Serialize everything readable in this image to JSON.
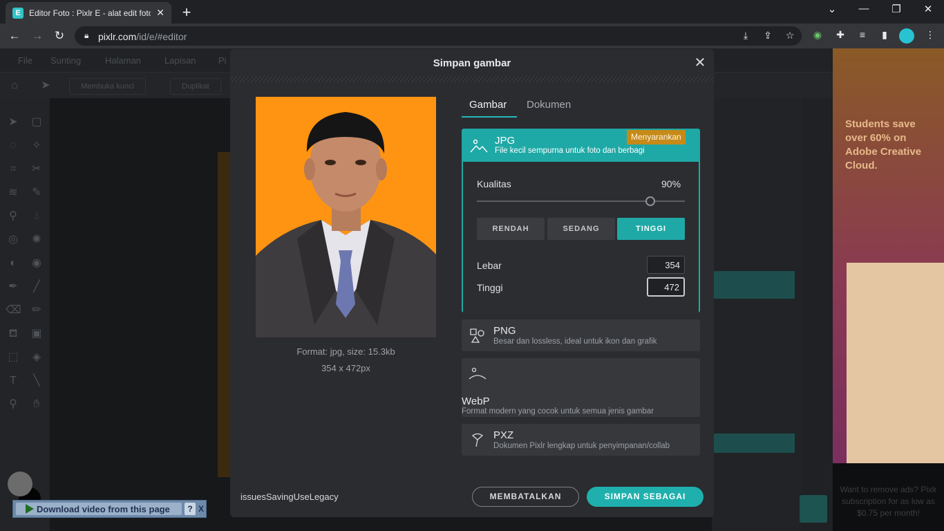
{
  "browser": {
    "tab_title": "Editor Foto : Pixlr E - alat edit foto",
    "favicon_letter": "E",
    "url_host": "pixlr.com",
    "url_path": "/id/e/#editor"
  },
  "app_bg": {
    "menu": [
      "File",
      "Sunting",
      "Halaman",
      "Lapisan",
      "Pi"
    ],
    "toolbar_buttons": [
      "Membuka kunci",
      "Duplikat"
    ],
    "ad_title": "Students save over 60% on Adobe Creative Cloud.",
    "ad_foot": "Want to remove ads? Pixlr subscription for as low as $0.75 per month!"
  },
  "download_bar": {
    "label": "Download video from this page",
    "help": "?",
    "close": "X"
  },
  "modal": {
    "title": "Simpan gambar",
    "close_icon": "✕",
    "preview_format": "Format: jpg, size: 15.3kb",
    "preview_dimensions": "354 x 472px",
    "tabs": [
      "Gambar",
      "Dokumen"
    ],
    "formats": {
      "jpg": {
        "name": "JPG",
        "desc": "File kecil sempurna untuk foto dan berbagi",
        "badge": "Menyarankan"
      },
      "png": {
        "name": "PNG",
        "desc": "Besar dan lossless, ideal untuk ikon dan grafik"
      },
      "webp": {
        "name": "WebP",
        "desc": "Format modern yang cocok untuk semua jenis gambar"
      },
      "pxz": {
        "name": "PXZ",
        "desc": "Dokumen Pixlr lengkap untuk penyimpanan/collab"
      }
    },
    "quality": {
      "label": "Kualitas",
      "value": "90%",
      "level": 0.9
    },
    "quality_presets": [
      "RENDAH",
      "SEDANG",
      "TINGGI"
    ],
    "width_label": "Lebar",
    "width_value": "354",
    "height_label": "Tinggi",
    "height_value": "472",
    "footer_label": "issuesSavingUseLegacy",
    "cancel_label": "MEMBATALKAN",
    "save_label": "SIMPAN SEBAGAI"
  },
  "colors": {
    "accent": "#1fa9a6",
    "badge": "#c68a18",
    "photo_bg": "#ff9412"
  }
}
